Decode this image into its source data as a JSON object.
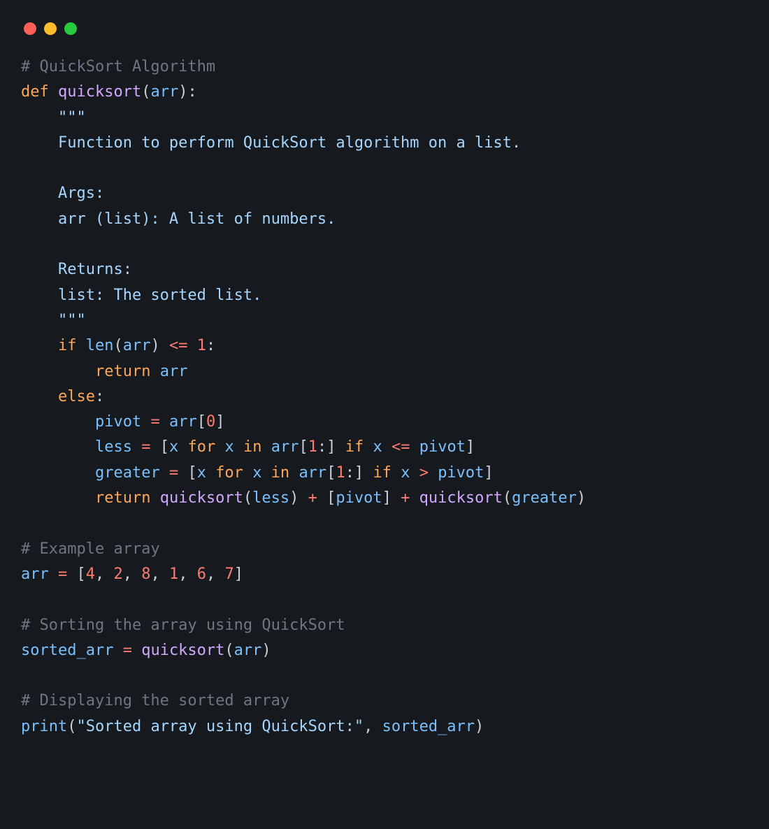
{
  "window": {
    "traffic_lights": [
      "red",
      "yellow",
      "green"
    ]
  },
  "code": {
    "c_algo": "# QuickSort Algorithm",
    "kw_def": "def",
    "fn_quicksort": "quicksort",
    "id_arr": "arr",
    "doc_open": "\"\"\"",
    "doc_l1": "Function to perform QuickSort algorithm on a list.",
    "doc_args_h": "Args:",
    "doc_args_l": "arr (list): A list of numbers.",
    "doc_ret_h": "Returns:",
    "doc_ret_l": "list: The sorted list.",
    "doc_close": "\"\"\"",
    "kw_if": "if",
    "bi_len": "len",
    "num_1a": "1",
    "kw_return1": "return",
    "kw_else": "else",
    "id_pivot": "pivot",
    "num_0": "0",
    "id_less": "less",
    "id_x": "x",
    "kw_for1": "for",
    "kw_in1": "in",
    "num_1b": "1",
    "kw_if2": "if",
    "id_greater": "greater",
    "kw_for2": "for",
    "kw_in2": "in",
    "num_1c": "1",
    "kw_if3": "if",
    "kw_return2": "return",
    "c_example": "# Example array",
    "arr_vals": [
      "4",
      "2",
      "8",
      "1",
      "6",
      "7"
    ],
    "c_sorting": "# Sorting the array using QuickSort",
    "id_sorted": "sorted_arr",
    "c_display": "# Displaying the sorted array",
    "bi_print": "print",
    "str_out": "\"Sorted array using QuickSort:\""
  }
}
